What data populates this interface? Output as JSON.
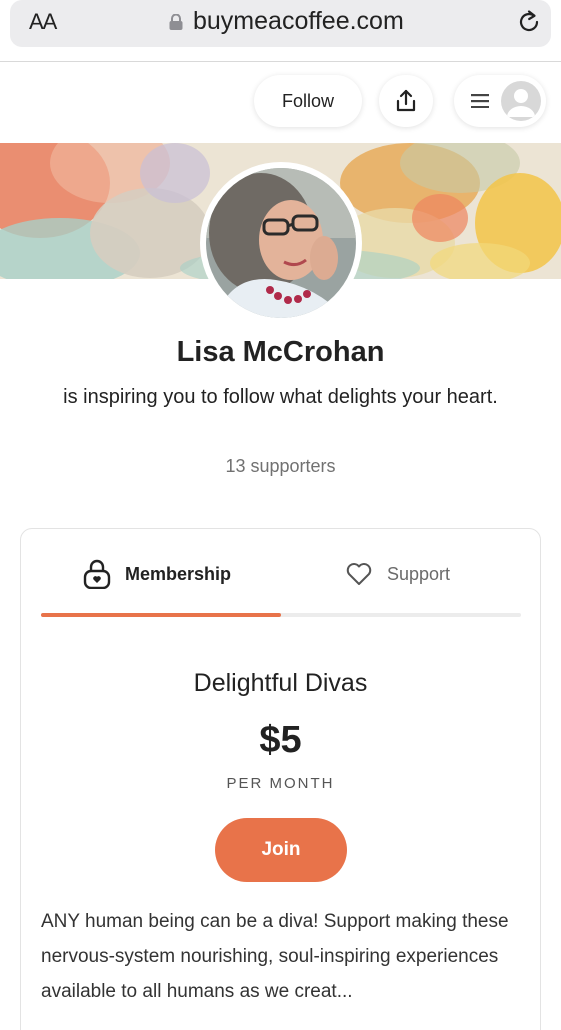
{
  "browser": {
    "text_size_label": "AA",
    "url": "buymeacoffee.com"
  },
  "header": {
    "follow_label": "Follow"
  },
  "profile": {
    "name": "Lisa McCrohan",
    "tagline": "is inspiring you to follow what delights your heart.",
    "supporters": "13 supporters"
  },
  "tabs": [
    {
      "label": "Membership",
      "active": true
    },
    {
      "label": "Support",
      "active": false
    }
  ],
  "membership": {
    "tier_name": "Delightful Divas",
    "price": "$5",
    "period": "PER MONTH",
    "join_label": "Join",
    "description": "ANY human being can be a diva!  Support making these nervous-system nourishing, soul-inspiring experiences available to all humans as we creat..."
  },
  "colors": {
    "accent": "#e8734a",
    "url_bar": "#ececee"
  }
}
